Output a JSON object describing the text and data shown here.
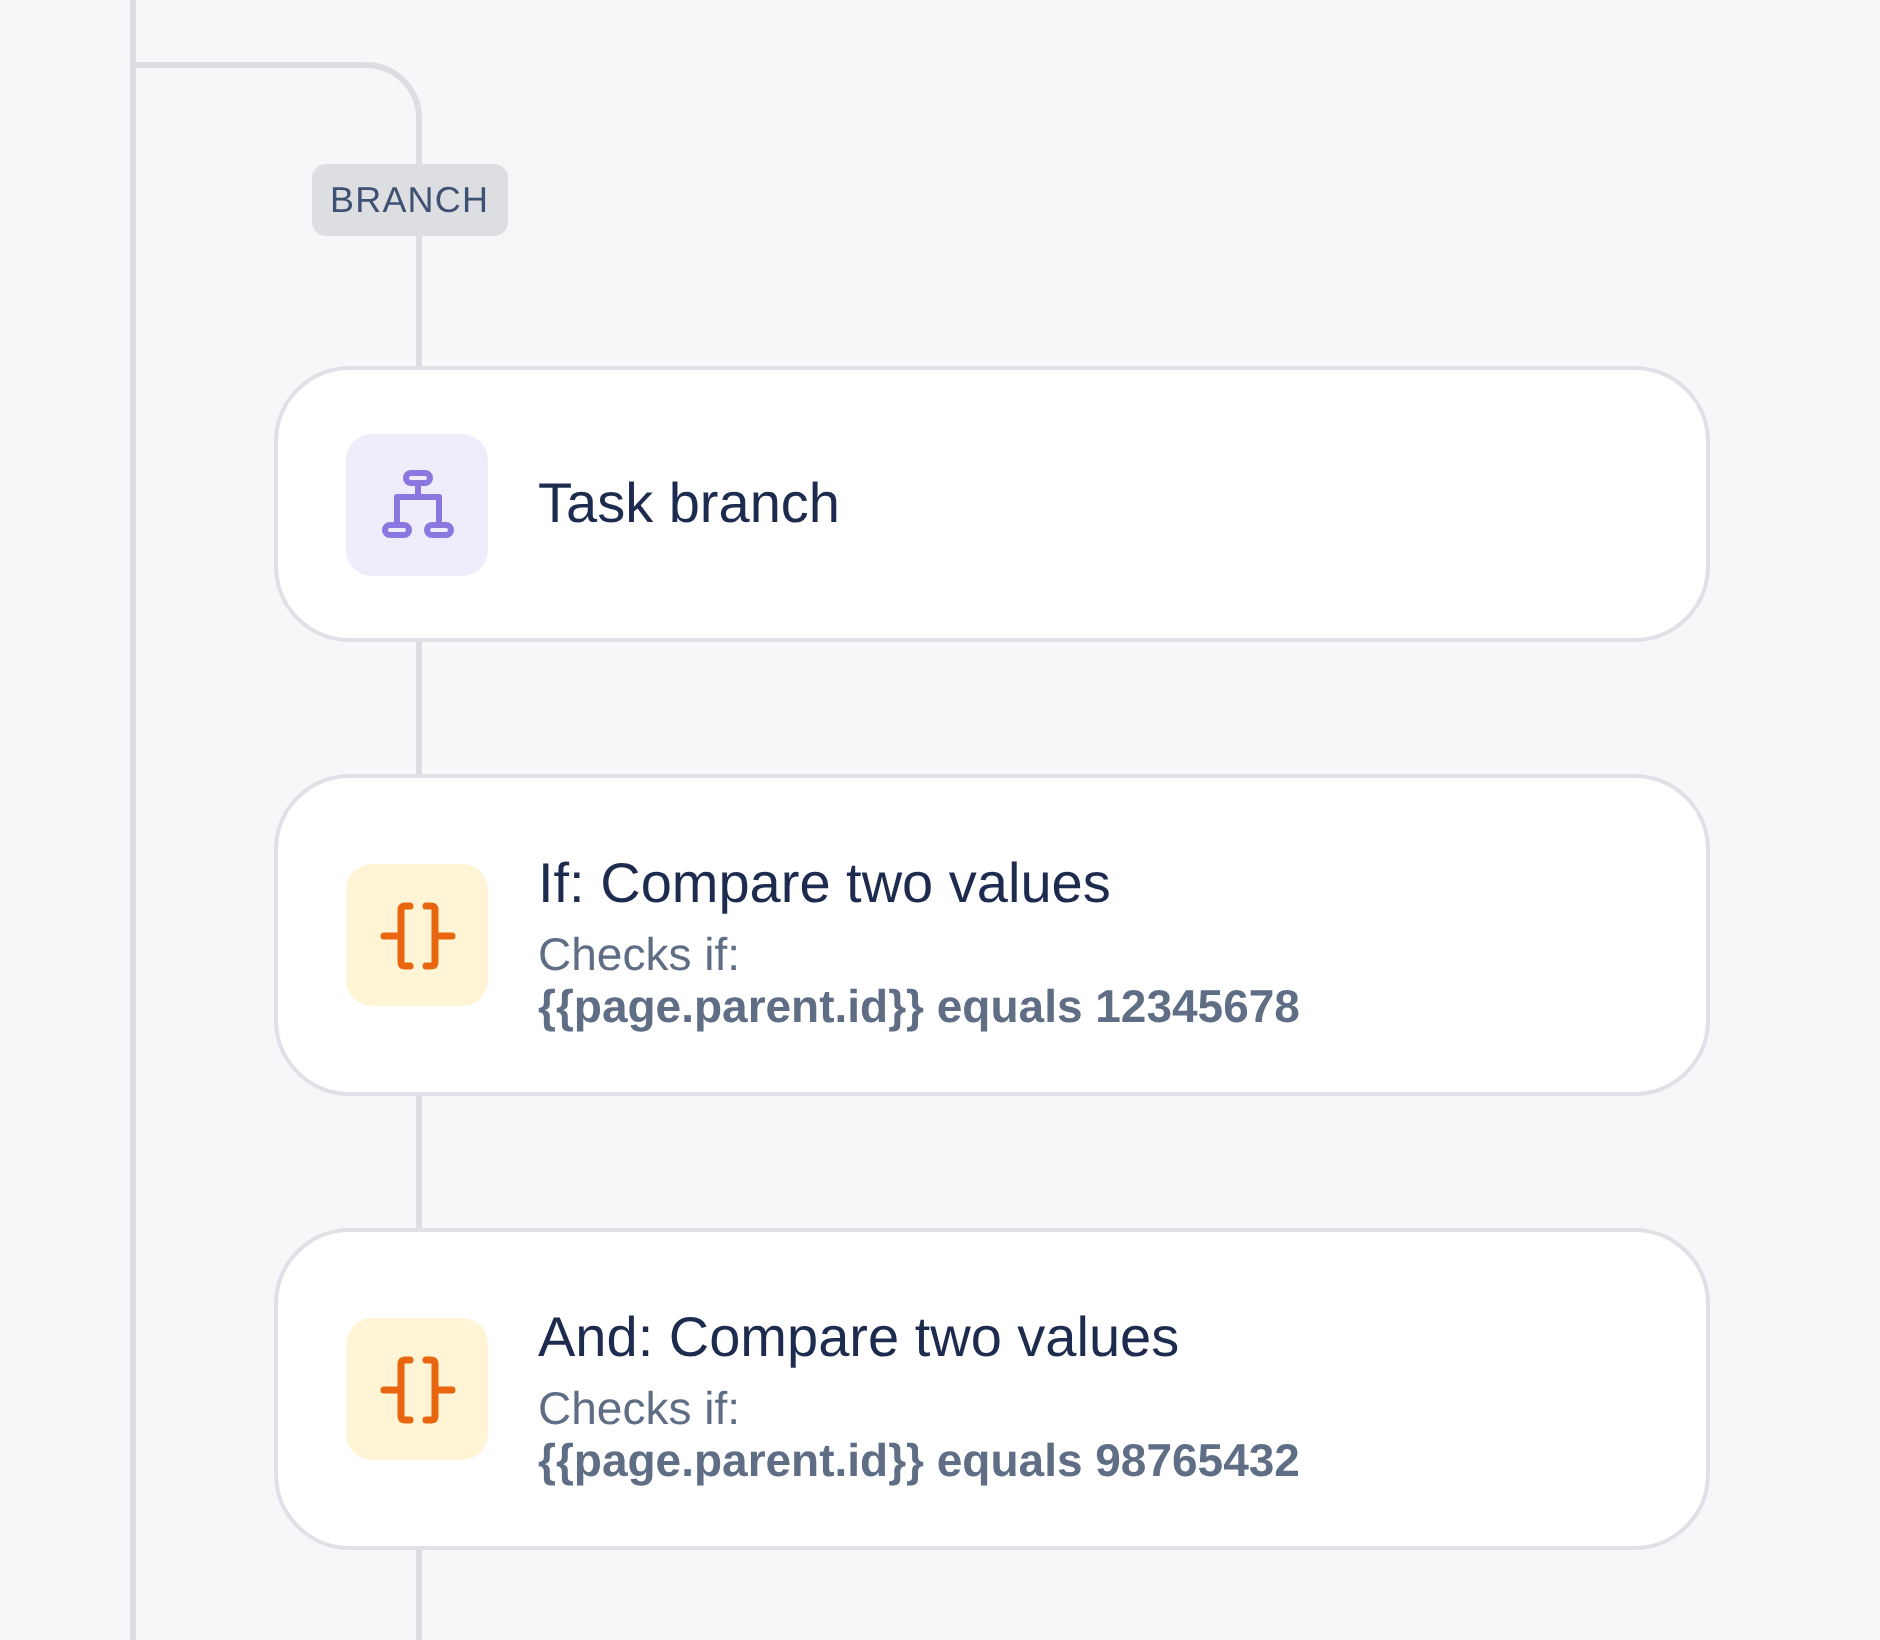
{
  "flow": {
    "branch_tag": "BRANCH",
    "steps": [
      {
        "kind": "branch",
        "title": "Task branch"
      },
      {
        "kind": "condition",
        "title": "If: Compare two values",
        "detail_label": "Checks if:",
        "detail": "{{page.parent.id}} equals 12345678"
      },
      {
        "kind": "condition",
        "title": "And: Compare two values",
        "detail_label": "Checks if:",
        "detail": "{{page.parent.id}} equals 98765432"
      }
    ]
  }
}
